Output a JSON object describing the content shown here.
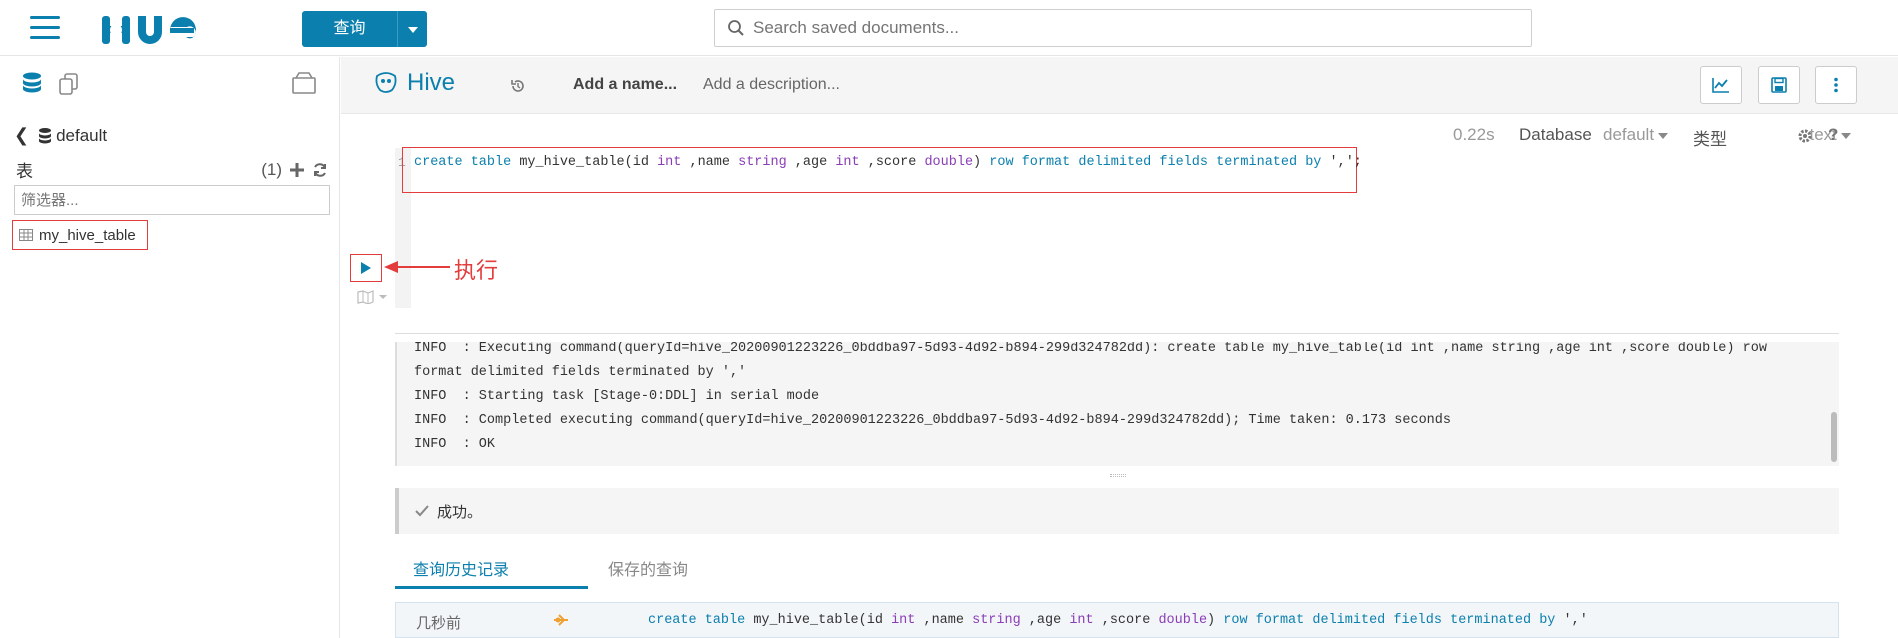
{
  "topbar": {
    "logo_text": "HUE",
    "query_button_label": "查询",
    "search_placeholder": "Search saved documents..."
  },
  "left_panel": {
    "database": "default",
    "tables_label": "表",
    "tables_count": "(1)",
    "filter_placeholder": "筛选器...",
    "tables": [
      "my_hive_table"
    ]
  },
  "editor_header": {
    "title": "Hive",
    "name_placeholder": "Add a name...",
    "description_placeholder": "Add a description..."
  },
  "snippet_meta": {
    "duration": "0.22s",
    "database_label": "Database",
    "database_value": "default",
    "type_label": "类型",
    "type_value": "text",
    "help": "?"
  },
  "editor": {
    "line_number": "1",
    "code_tokens": [
      {
        "t": "create table ",
        "c": "kw"
      },
      {
        "t": "my_hive_table(id ",
        "c": ""
      },
      {
        "t": "int",
        "c": "ty"
      },
      {
        "t": " ,name ",
        "c": ""
      },
      {
        "t": "string",
        "c": "ty"
      },
      {
        "t": " ,age ",
        "c": ""
      },
      {
        "t": "int",
        "c": "ty"
      },
      {
        "t": " ,score ",
        "c": ""
      },
      {
        "t": "double",
        "c": "ty"
      },
      {
        "t": ") ",
        "c": ""
      },
      {
        "t": "row format delimited fields terminated by",
        "c": "kw"
      },
      {
        "t": " ',';",
        "c": ""
      }
    ]
  },
  "annotation": {
    "text": "执行"
  },
  "log": {
    "lines": [
      "INFO  : Executing command(queryId=hive_20200901223226_0bddba97-5d93-4d92-b894-299d324782dd): create table my_hive_table(id int ,name string ,age int ,score double) row",
      "format delimited fields terminated by ','",
      "INFO  : Starting task [Stage-0:DDL] in serial mode",
      "INFO  : Completed executing command(queryId=hive_20200901223226_0bddba97-5d93-4d92-b894-299d324782dd); Time taken: 0.173 seconds",
      "INFO  : OK"
    ]
  },
  "status": {
    "message": "成功。"
  },
  "tabs": {
    "history": "查询历史记录",
    "saved": "保存的查询"
  },
  "history": {
    "time": "几秒前",
    "code_tokens": [
      {
        "t": "create table ",
        "c": "kw"
      },
      {
        "t": "my_hive_table(id ",
        "c": ""
      },
      {
        "t": "int",
        "c": "ty"
      },
      {
        "t": " ,name ",
        "c": ""
      },
      {
        "t": "string",
        "c": "ty"
      },
      {
        "t": " ,age ",
        "c": ""
      },
      {
        "t": "int",
        "c": "ty"
      },
      {
        "t": " ,score ",
        "c": ""
      },
      {
        "t": "double",
        "c": "ty"
      },
      {
        "t": ") ",
        "c": ""
      },
      {
        "t": "row format delimited fields terminated by",
        "c": "kw"
      },
      {
        "t": " ','",
        "c": ""
      }
    ]
  },
  "colors": {
    "accent": "#0b7fad",
    "annotation": "#e23c3c"
  }
}
